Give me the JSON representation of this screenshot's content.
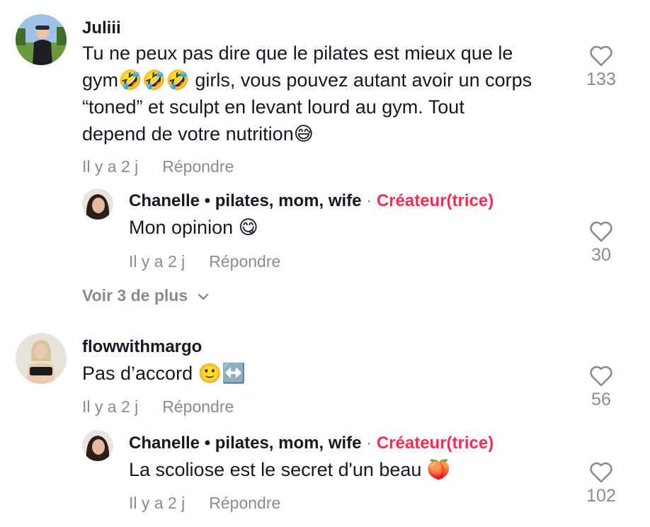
{
  "comments": [
    {
      "username": "Juliii",
      "lines": [
        "Tu ne peux pas dire que le pilates est mieux que le",
        "gym🤣🤣🤣 girls, vous pouvez autant avoir un corps",
        "“toned” et sculpt en levant lourd au gym. Tout",
        "depend de votre nutrition😅"
      ],
      "time": "Il y a 2 j",
      "reply": "Répondre",
      "likes": "133",
      "replies": [
        {
          "username": "Chanelle • pilates, mom, wife",
          "badge": "Créateur(trice)",
          "text": "Mon opinion 😋",
          "time": "Il y a 2 j",
          "reply": "Répondre",
          "likes": "30"
        }
      ],
      "more": "Voir 3 de plus"
    },
    {
      "username": "flowwithmargo",
      "text": "Pas d’accord 🙂↔️",
      "time": "Il y a 2 j",
      "reply": "Répondre",
      "likes": "56",
      "replies": [
        {
          "username": "Chanelle • pilates, mom, wife",
          "badge": "Créateur(trice)",
          "text": "La scoliose est le secret d'un beau 🍑",
          "time": "Il y a 2 j",
          "reply": "Répondre",
          "likes": "102"
        }
      ]
    }
  ],
  "separator": "·",
  "colors": {
    "creator": "#fe2c55",
    "meta": "#8a8b91",
    "text": "#161823"
  },
  "icons": {
    "like": "heart-outline-icon",
    "expand": "chevron-down-icon"
  }
}
